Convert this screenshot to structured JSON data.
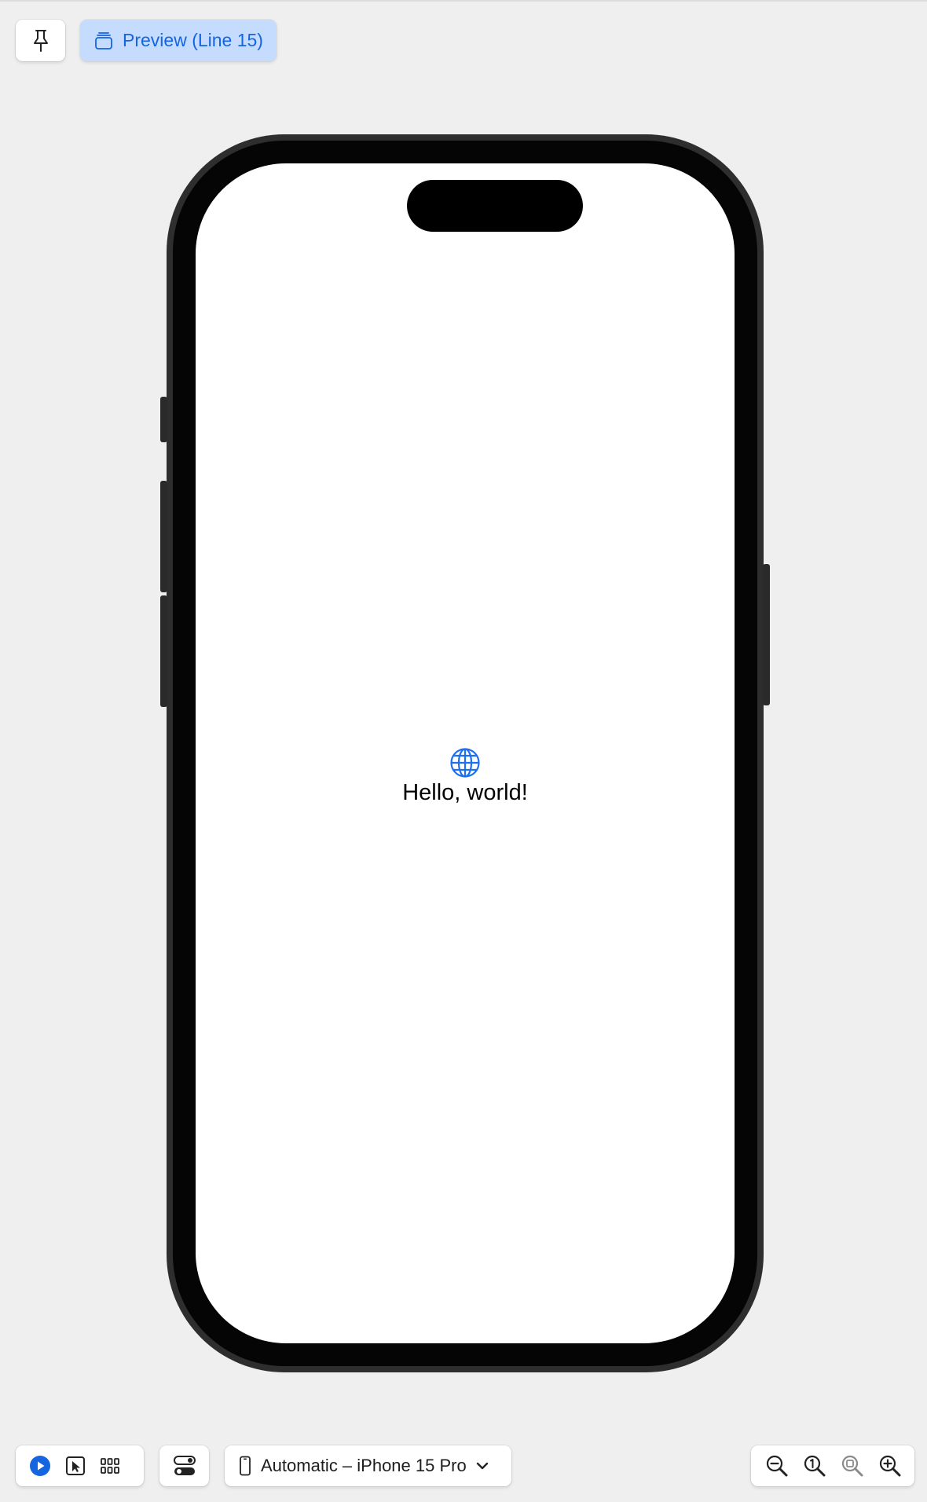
{
  "toolbar": {
    "pin_icon": "pin-icon",
    "preview_tab_label": "Preview (Line 15)",
    "preview_tab_icon": "stacked-windows-icon",
    "accent_color": "#1565e0",
    "tab_bg_color": "#c6dcff"
  },
  "device": {
    "model": "iPhone 15 Pro",
    "screen_background": "#ffffff"
  },
  "content": {
    "icon": "globe-icon",
    "icon_color": "#1e6ff0",
    "text": "Hello, world!"
  },
  "bottom_bar": {
    "live_mode_icon": "play-circle-icon",
    "selectable_mode_icon": "cursor-select-icon",
    "variants_icon": "grid-icon",
    "device_settings_icon": "toggles-icon",
    "device_selector_label": "Automatic – iPhone 15 Pro",
    "device_selector_icon": "iphone-icon",
    "zoom_out_icon": "zoom-out-icon",
    "zoom_actual_icon": "zoom-100-icon",
    "zoom_fit_icon": "zoom-fit-icon",
    "zoom_in_icon": "zoom-in-icon"
  }
}
